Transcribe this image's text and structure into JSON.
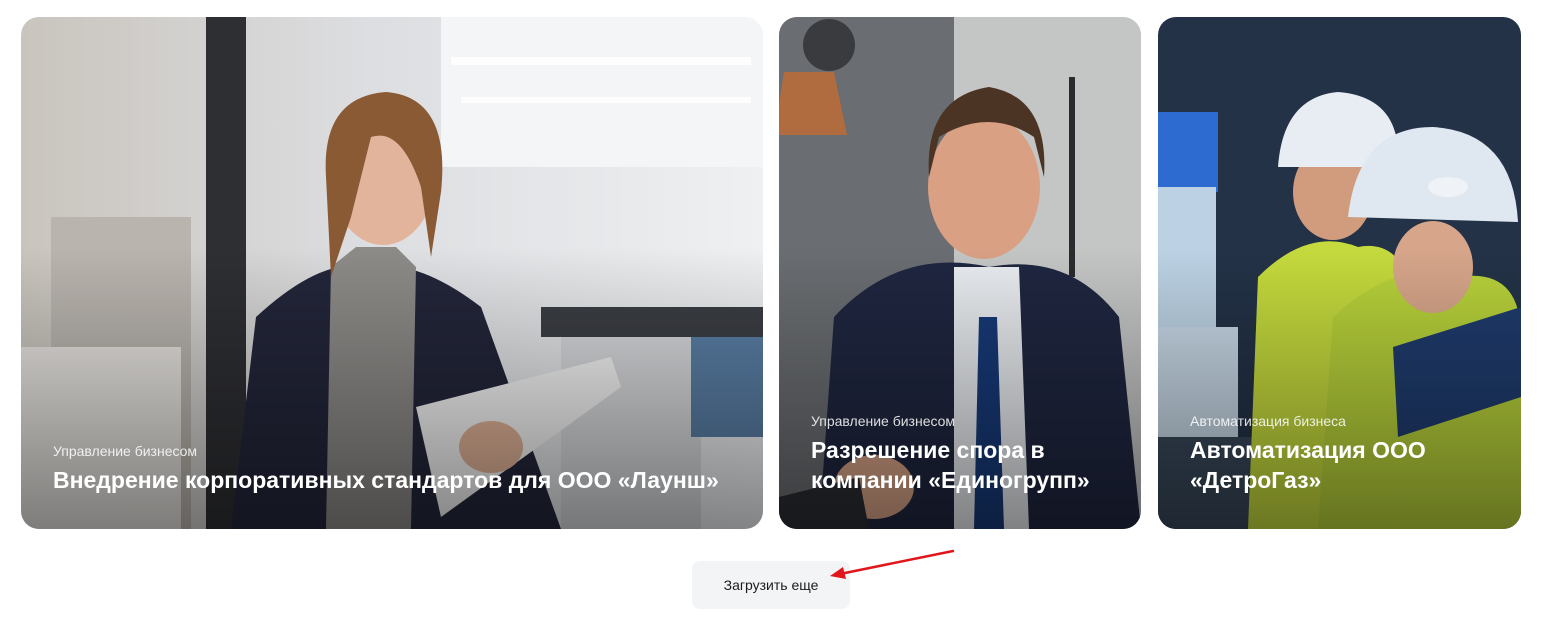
{
  "cards": [
    {
      "category": "Управление бизнесом",
      "title": "Внедрение корпоративных стандартов для ООО «Лаунш»",
      "image": "office-woman-photo"
    },
    {
      "category": "Управление бизнесом",
      "title": "Разрешение спора в компании «Единогрупп»",
      "image": "handshake-businessman-photo"
    },
    {
      "category": "Автоматизация бизнеса",
      "title": "Автоматизация ООО «ДетроГаз»",
      "image": "engineers-control-room-photo"
    }
  ],
  "load_more": {
    "label": "Загрузить еще"
  },
  "annotation": {
    "color": "#e0161c",
    "icon": "red-arrow"
  }
}
